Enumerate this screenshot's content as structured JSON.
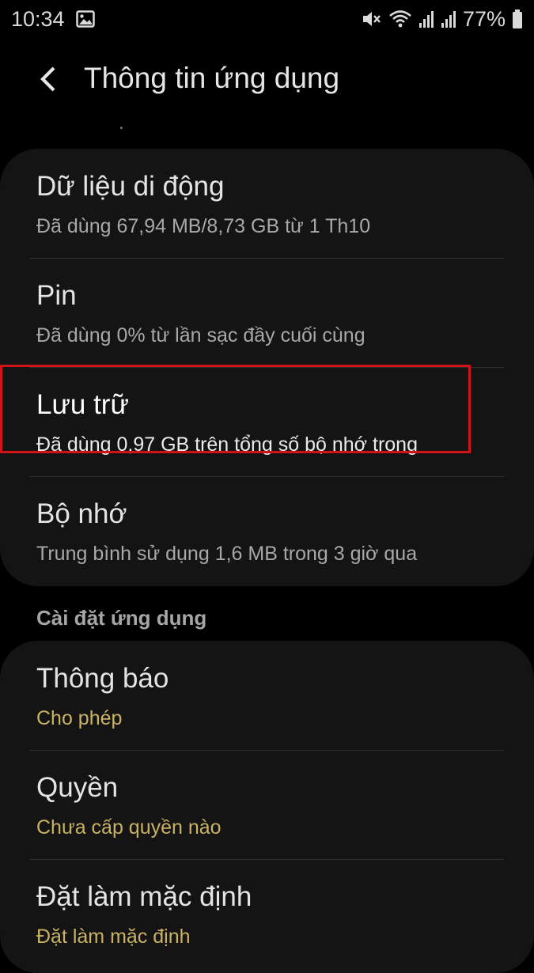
{
  "status_bar": {
    "time": "10:34",
    "battery_percent": "77%",
    "icons": [
      "gallery-icon",
      "mute-icon",
      "wifi-icon",
      "signal-icon",
      "signal-icon",
      "battery-icon"
    ]
  },
  "header": {
    "back_icon": "chevron-left-icon",
    "title": "Thông tin ứng dụng"
  },
  "usage_card": {
    "items": [
      {
        "title": "Dữ liệu di động",
        "subtitle": "Đã dùng 67,94 MB/8,73 GB từ 1 Th10"
      },
      {
        "title": "Pin",
        "subtitle": "Đã dùng 0% từ lần sạc đầy cuối cùng"
      },
      {
        "title": "Lưu trữ",
        "subtitle": "Đã dùng 0,97 GB trên tổng số bộ nhớ trong",
        "highlighted": true
      },
      {
        "title": "Bộ nhớ",
        "subtitle": "Trung bình sử dụng 1,6 MB trong 3 giờ qua"
      }
    ]
  },
  "app_settings": {
    "section_title": "Cài đặt ứng dụng",
    "items": [
      {
        "title": "Thông báo",
        "subtitle": "Cho phép"
      },
      {
        "title": "Quyền",
        "subtitle": "Chưa cấp quyền nào"
      },
      {
        "title": "Đặt làm mặc định",
        "subtitle": "Đặt làm mặc định"
      }
    ]
  },
  "colors": {
    "background": "#000000",
    "card": "#141414",
    "accent_subtitle": "#c9b263",
    "highlight_border": "#d0121b"
  }
}
